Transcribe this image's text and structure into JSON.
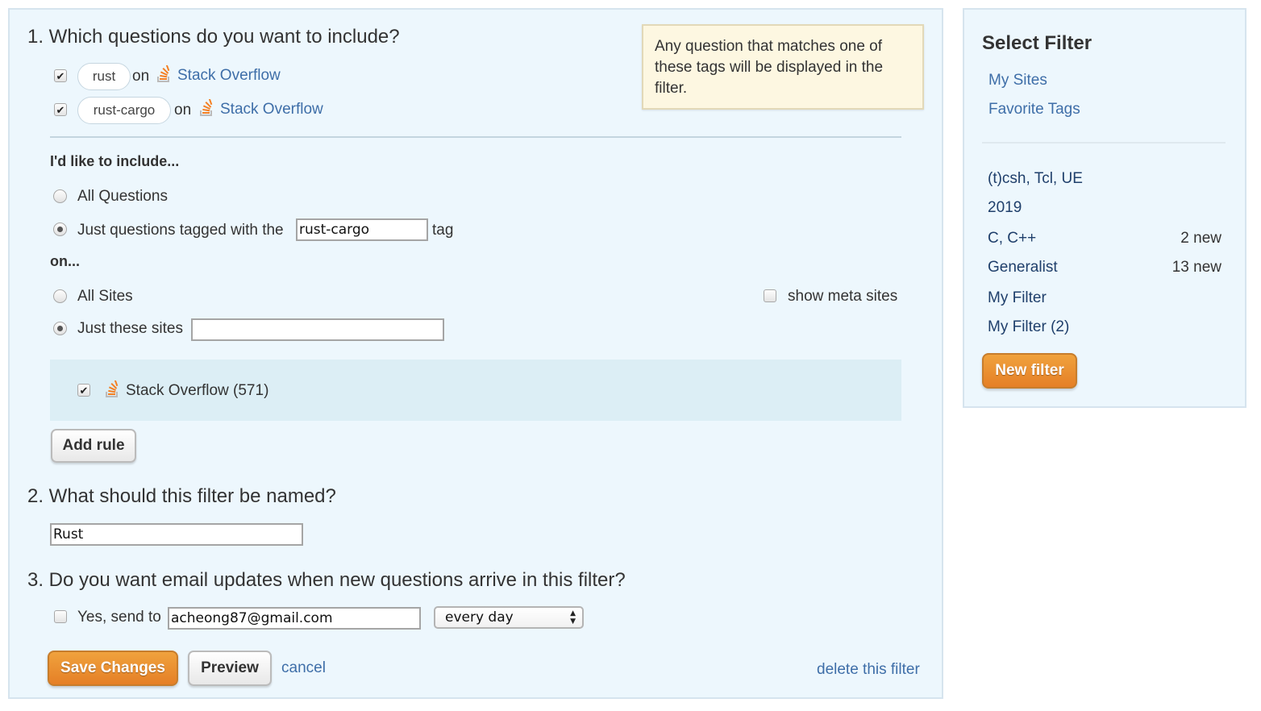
{
  "main": {
    "section1": {
      "heading": "1. Which questions do you want to include?",
      "rules": [
        {
          "checked": true,
          "tag": "rust",
          "on_label": "on",
          "site": "Stack Overflow"
        },
        {
          "checked": true,
          "tag": "rust-cargo",
          "on_label": "on",
          "site": "Stack Overflow"
        }
      ],
      "tooltip": "Any question that matches one of these tags will be displayed in the filter.",
      "include_label": "I'd like to include...",
      "all_questions_label": "All Questions",
      "tagged_label": "Just questions tagged with the",
      "tag_value": "rust-cargo",
      "tag_suffix": "tag",
      "on_label": "on...",
      "all_sites_label": "All Sites",
      "show_meta_label": "show meta sites",
      "just_sites_label": "Just these sites",
      "sites_input_value": "",
      "site_list": [
        {
          "checked": true,
          "label": "Stack Overflow (571)"
        }
      ],
      "add_rule_label": "Add rule",
      "selected_include": "tagged",
      "selected_sites": "just"
    },
    "section2": {
      "heading": "2. What should this filter be named?",
      "name_value": "Rust"
    },
    "section3": {
      "heading": "3. Do you want email updates when new questions arrive in this filter?",
      "email_checked": false,
      "send_label": "Yes, send to",
      "email_value": "acheong87@gmail.com",
      "frequency": "every day"
    },
    "actions": {
      "save_label": "Save Changes",
      "preview_label": "Preview",
      "cancel_label": "cancel",
      "delete_label": "delete this filter"
    }
  },
  "sidebar": {
    "title": "Select Filter",
    "links": [
      "My Sites",
      "Favorite Tags"
    ],
    "filters": [
      {
        "name": "(t)csh, Tcl, UE",
        "count": ""
      },
      {
        "name": "2019",
        "count": ""
      },
      {
        "name": "C, C++",
        "count": "2 new"
      },
      {
        "name": "Generalist",
        "count": "13 new"
      },
      {
        "name": "My Filter",
        "count": ""
      },
      {
        "name": "My Filter (2)",
        "count": ""
      }
    ],
    "new_filter_label": "New filter"
  },
  "colors": {
    "panel_bg": "#edf7fd",
    "link": "#3e6ea8",
    "accent_orange": "#e8892d",
    "tooltip_bg": "#fdf7e1"
  }
}
